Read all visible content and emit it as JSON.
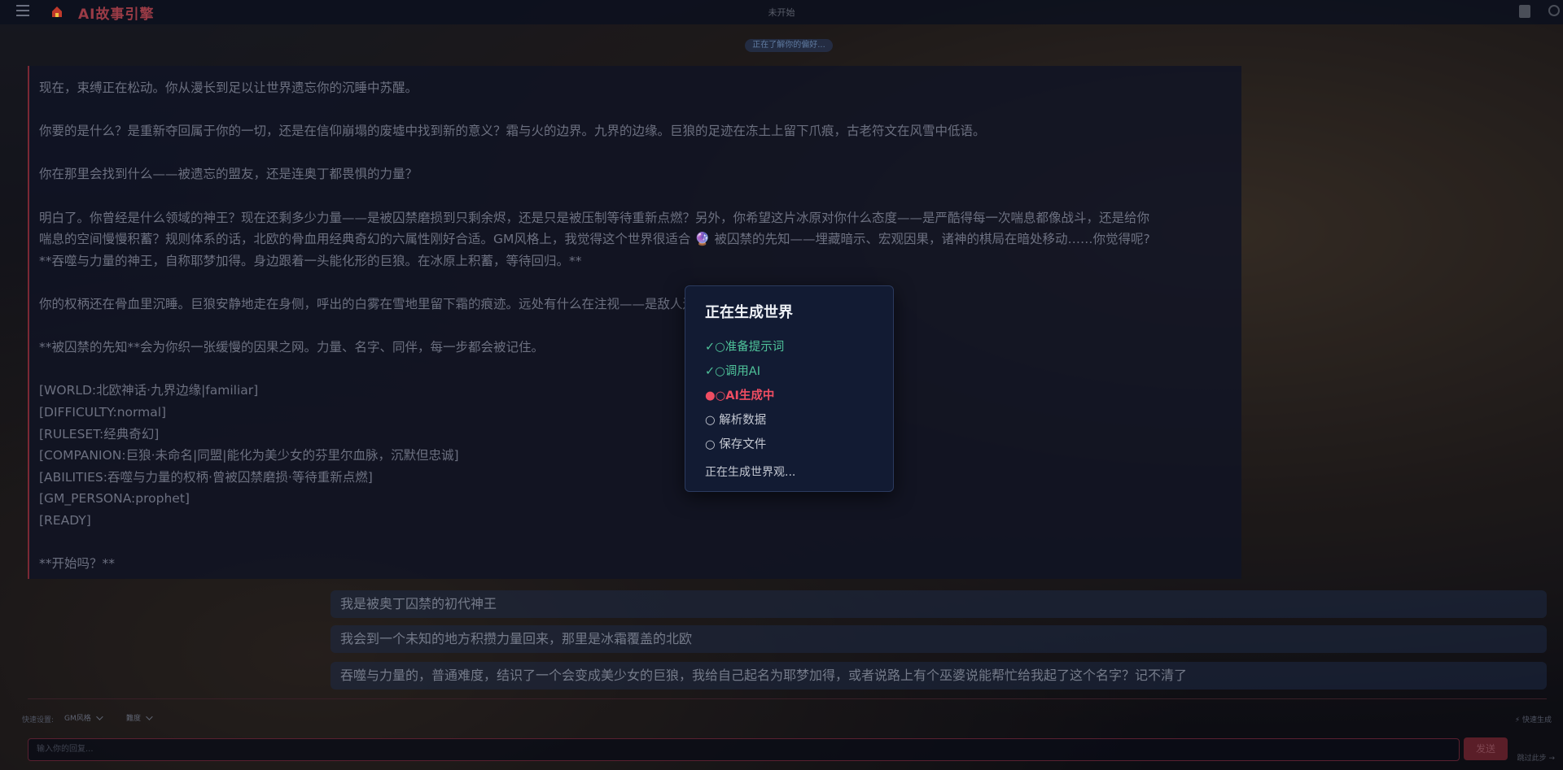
{
  "header": {
    "app_title": "AI故事引擎",
    "status": "未开始",
    "pill": "正在了解你的偏好..."
  },
  "story": {
    "paragraphs": [
      "现在，束缚正在松动。你从漫长到足以让世界遗忘你的沉睡中苏醒。",
      "你要的是什么？是重新夺回属于你的一切，还是在信仰崩塌的废墟中找到新的意义？霜与火的边界。九界的边缘。巨狼的足迹在冻土上留下爪痕，古老符文在风雪中低语。",
      "你在那里会找到什么——被遗忘的盟友，还是连奥丁都畏惧的力量？",
      "明白了。你曾经是什么领域的神王？现在还剩多少力量——是被囚禁磨损到只剩余烬，还是只是被压制等待重新点燃？另外，你希望这片冰原对你什么态度——是严酷得每一次喘息都像战斗，还是给你",
      "喘息的空间慢慢积蓄？规则体系的话，北欧的骨血用经典奇幻的六属性刚好合适。GM风格上，我觉得这个世界很适合 🔮 被囚禁的先知——埋藏暗示、宏观因果，诸神的棋局在暗处移动……你觉得呢?",
      "**吞噬与力量的神王，自称耶梦加得。身边跟着一头能化形的巨狼。在冰原上积蓄，等待回归。**",
      "你的权柄还在骨血里沉睡。巨狼安静地走在身侧，呼出的白雾在雪地里留下霜的痕迹。远处有什么在注视——是敌人还是命运，你还不知道它想要的什么。",
      "**被囚禁的先知**会为你织一张缓慢的因果之网。力量、名字、同伴，每一步都会被记住。",
      "[WORLD:北欧神话·九界边缘|familiar]",
      "[DIFFICULTY:normal]",
      "[RULESET:经典奇幻]",
      "[COMPANION:巨狼·未命名|同盟|能化为美少女的芬里尔血脉，沉默但忠诚]",
      "[ABILITIES:吞噬与力量的权柄·曾被囚禁磨损·等待重新点燃]",
      "[GM_PERSONA:prophet]",
      "[READY]",
      "**开始吗？**"
    ]
  },
  "user_messages": [
    "我是被奥丁囚禁的初代神王",
    "我会到一个未知的地方积攒力量回来，那里是冰霜覆盖的北欧",
    "吞噬与力量的，普通难度，结识了一个会变成美少女的巨狼，我给自己起名为耶梦加得，或者说路上有个巫婆说能帮忙给我起了这个名字？记不清了"
  ],
  "controls": {
    "quick_settings_label": "快速设置:",
    "gm_style_select": "GM风格",
    "difficulty_select": "難度",
    "fast_generate": "⚡ 快速生成",
    "input_placeholder": "输入你的回复...",
    "send_label": "发送",
    "skip_label": "跳过此步 →"
  },
  "modal": {
    "title": "正在生成世界",
    "steps": [
      {
        "label": "✓○准备提示词",
        "state": "done"
      },
      {
        "label": "✓○调用AI",
        "state": "done"
      },
      {
        "label": "●○AI生成中",
        "state": "active"
      },
      {
        "label": "○ 解析数据",
        "state": "pending"
      },
      {
        "label": "○ 保存文件",
        "state": "pending"
      }
    ],
    "status": "正在生成世界观..."
  },
  "colors": {
    "accent": "#ef4d62",
    "done": "#4fc39a",
    "brand": "#9a3b46"
  }
}
